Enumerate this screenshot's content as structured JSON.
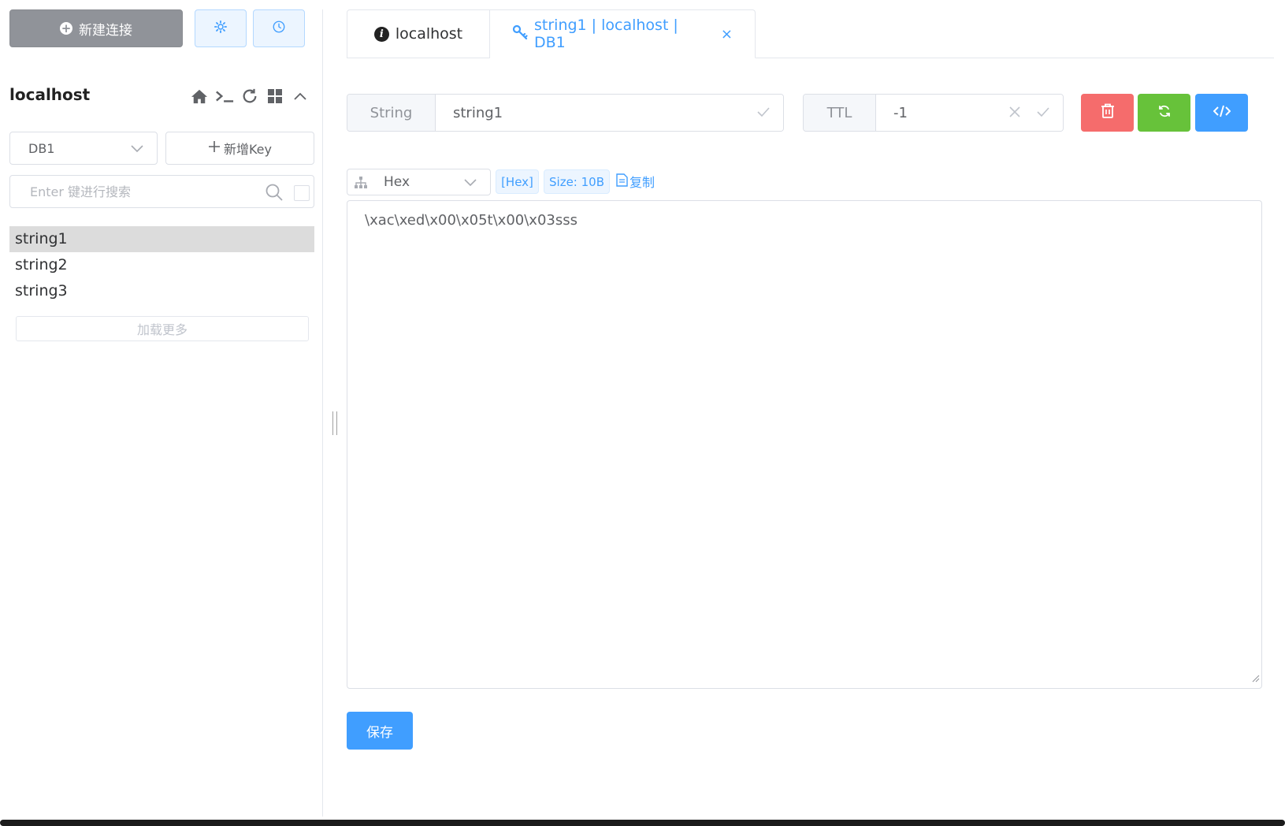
{
  "sidebar": {
    "new_connection_label": "新建连接",
    "connection_name": "localhost",
    "db_selected": "DB1",
    "new_key_label": "新增Key",
    "search_placeholder": "Enter 键进行搜索",
    "keys": [
      "string1",
      "string2",
      "string3"
    ],
    "load_more_label": "加载更多"
  },
  "tabs": [
    {
      "label": "localhost",
      "icon": "info-icon"
    },
    {
      "label": "string1 | localhost | DB1",
      "icon": "key-icon"
    }
  ],
  "key_editor": {
    "type_label": "String",
    "key_name": "string1",
    "ttl_label": "TTL",
    "ttl_value": "-1",
    "format": "Hex",
    "format_tag": "[Hex]",
    "size_tag": "Size: 10B",
    "copy_label": "复制",
    "value": "\\xac\\xed\\x00\\x05t\\x00\\x03sss",
    "save_label": "保存"
  },
  "colors": {
    "primary": "#409eff",
    "danger": "#f56c6c",
    "success": "#67c23a",
    "info": "#909399",
    "active_row": "#dcdcdc"
  }
}
